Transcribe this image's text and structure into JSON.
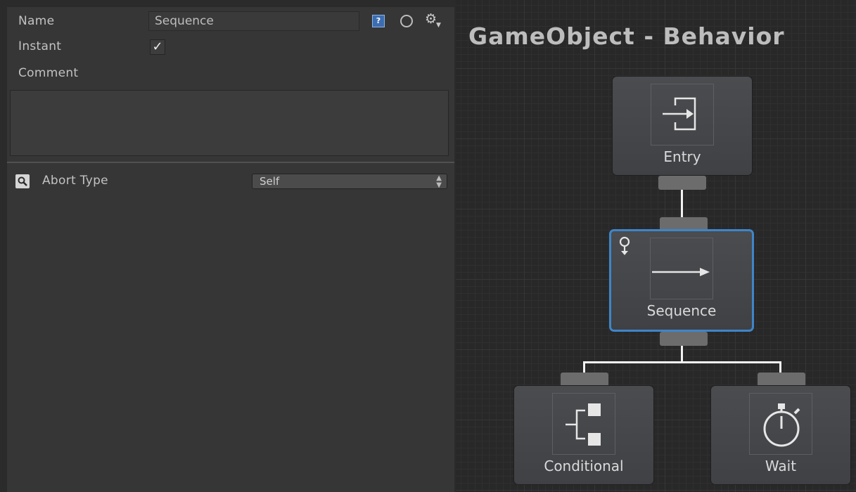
{
  "inspector": {
    "name_label": "Name",
    "name_value": "Sequence",
    "instant_label": "Instant",
    "instant_checked": true,
    "checkmark": "✓",
    "comment_label": "Comment",
    "comment_value": "",
    "abort_type_label": "Abort Type",
    "abort_type_value": "Self",
    "icons": [
      "help-icon",
      "circle-icon",
      "gear-icon",
      "search-icon"
    ]
  },
  "graph": {
    "title": "GameObject - Behavior",
    "nodes": [
      {
        "label": "Entry",
        "icon": "entry-icon"
      },
      {
        "label": "Sequence",
        "icon": "sequence-arrow-icon",
        "selected": true
      },
      {
        "label": "Conditional",
        "icon": "conditional-icon"
      },
      {
        "label": "Wait",
        "icon": "stopwatch-icon"
      }
    ]
  },
  "colors": {
    "selection": "#3f85c9",
    "background": "#2b2b2b",
    "panel": "#363636"
  }
}
